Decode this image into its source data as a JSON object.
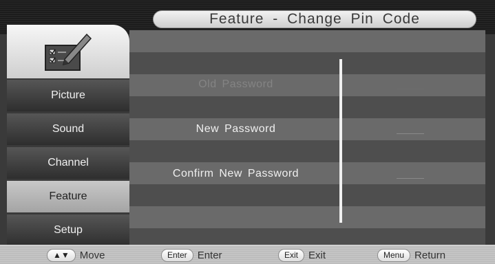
{
  "title": "Feature - Change Pin Code",
  "menu": [
    {
      "label": "Picture",
      "active": false
    },
    {
      "label": "Sound",
      "active": false
    },
    {
      "label": "Channel",
      "active": false
    },
    {
      "label": "Feature",
      "active": true
    },
    {
      "label": "Setup",
      "active": false
    }
  ],
  "form": {
    "old_password": "Old Password",
    "new_password": "New Password",
    "confirm_password": "Confirm New Password"
  },
  "hints": {
    "move_key": "▲▼",
    "move_label": "Move",
    "enter_key": "Enter",
    "enter_label": "Enter",
    "exit_key": "Exit",
    "exit_label": "Exit",
    "menu_key": "Menu",
    "menu_label": "Return"
  },
  "colors": {
    "active_item": "#b6b6b6",
    "stripe_light": "#6a6a6a",
    "stripe_dark": "#4e4e4e",
    "title_bar": "#e6e6e6"
  },
  "icons": {
    "logo": "checklist-pencil-icon"
  }
}
